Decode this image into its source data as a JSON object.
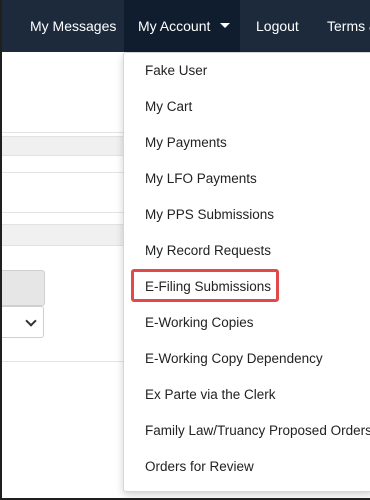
{
  "navbar": {
    "items": [
      {
        "label": "My Messages"
      },
      {
        "label": "My Account"
      },
      {
        "label": "Logout"
      },
      {
        "label": "Terms &"
      }
    ]
  },
  "dropdown": {
    "items": [
      {
        "label": "Fake User"
      },
      {
        "label": "My Cart"
      },
      {
        "label": "My Payments"
      },
      {
        "label": "My LFO Payments"
      },
      {
        "label": "My PPS Submissions"
      },
      {
        "label": "My Record Requests"
      },
      {
        "label": "E-Filing Submissions",
        "highlighted": true
      },
      {
        "label": "E-Working Copies"
      },
      {
        "label": "E-Working Copy Dependency"
      },
      {
        "label": "Ex Parte via the Clerk"
      },
      {
        "label": "Family Law/Truancy Proposed Orders"
      },
      {
        "label": "Orders for Review"
      }
    ]
  },
  "colors": {
    "navbar_bg": "#1c2a3c",
    "active_nav_bg": "#101d2e",
    "highlight_border": "#e04a4a"
  },
  "icons": {
    "account_caret": "caret-down-icon",
    "select_chevron": "chevron-down-icon"
  }
}
